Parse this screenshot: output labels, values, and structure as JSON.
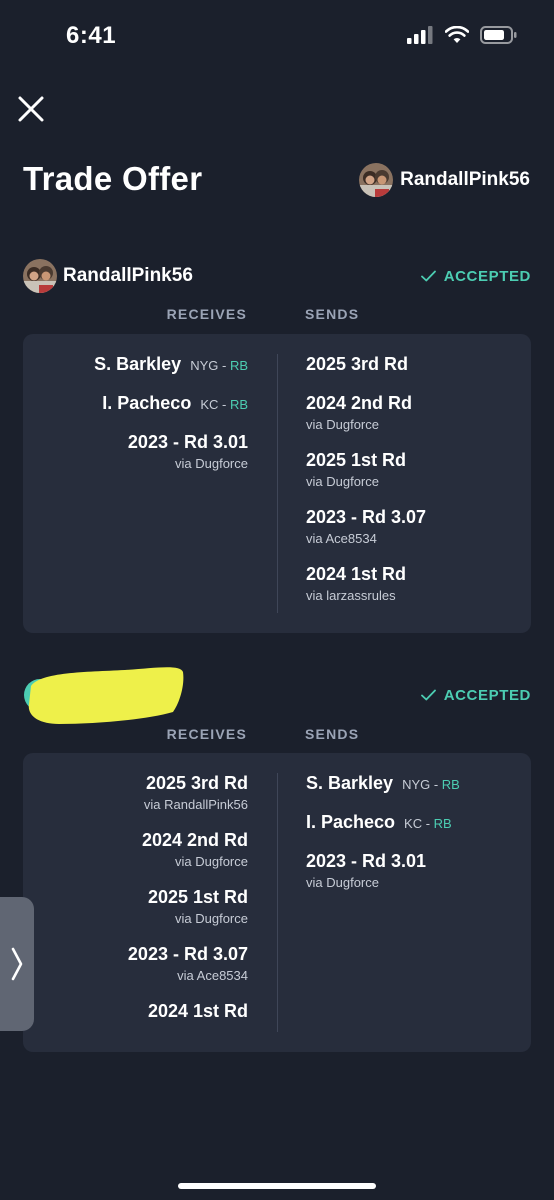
{
  "status": {
    "time": "6:41"
  },
  "header": {
    "title": "Trade Offer",
    "username": "RandallPink56"
  },
  "trades": [
    {
      "username": "RandallPink56",
      "status": "ACCEPTED",
      "receives_label": "RECEIVES",
      "sends_label": "SENDS",
      "receives": [
        {
          "name": "S. Barkley",
          "team": "NYG",
          "position": "RB"
        },
        {
          "name": "I. Pacheco",
          "team": "KC",
          "position": "RB"
        },
        {
          "name": "2023 - Rd 3.01",
          "via": "via Dugforce"
        }
      ],
      "sends": [
        {
          "name": "2025 3rd Rd"
        },
        {
          "name": "2024 2nd Rd",
          "via": "via Dugforce"
        },
        {
          "name": "2025 1st Rd",
          "via": "via Dugforce"
        },
        {
          "name": "2023 - Rd 3.07",
          "via": "via Ace8534"
        },
        {
          "name": "2024 1st Rd",
          "via": "via larzassrules"
        }
      ]
    },
    {
      "username": "",
      "status": "ACCEPTED",
      "receives_label": "RECEIVES",
      "sends_label": "SENDS",
      "receives": [
        {
          "name": "2025 3rd Rd",
          "via": "via RandallPink56"
        },
        {
          "name": "2024 2nd Rd",
          "via": "via Dugforce"
        },
        {
          "name": "2025 1st Rd",
          "via": "via Dugforce"
        },
        {
          "name": "2023 - Rd 3.07",
          "via": "via Ace8534"
        },
        {
          "name": "2024 1st Rd"
        }
      ],
      "sends": [
        {
          "name": "S. Barkley",
          "team": "NYG",
          "position": "RB"
        },
        {
          "name": "I. Pacheco",
          "team": "KC",
          "position": "RB"
        },
        {
          "name": "2023 - Rd 3.01",
          "via": "via Dugforce"
        }
      ]
    }
  ],
  "colors": {
    "background": "#1b202c",
    "card": "#272d3c",
    "accent": "#4ccdb2",
    "label": "#9ba4b6",
    "redaction": "#eef04a"
  },
  "icons": {
    "close": "close-icon",
    "accepted": "check-icon",
    "side_tab": "chevron-right-icon"
  }
}
